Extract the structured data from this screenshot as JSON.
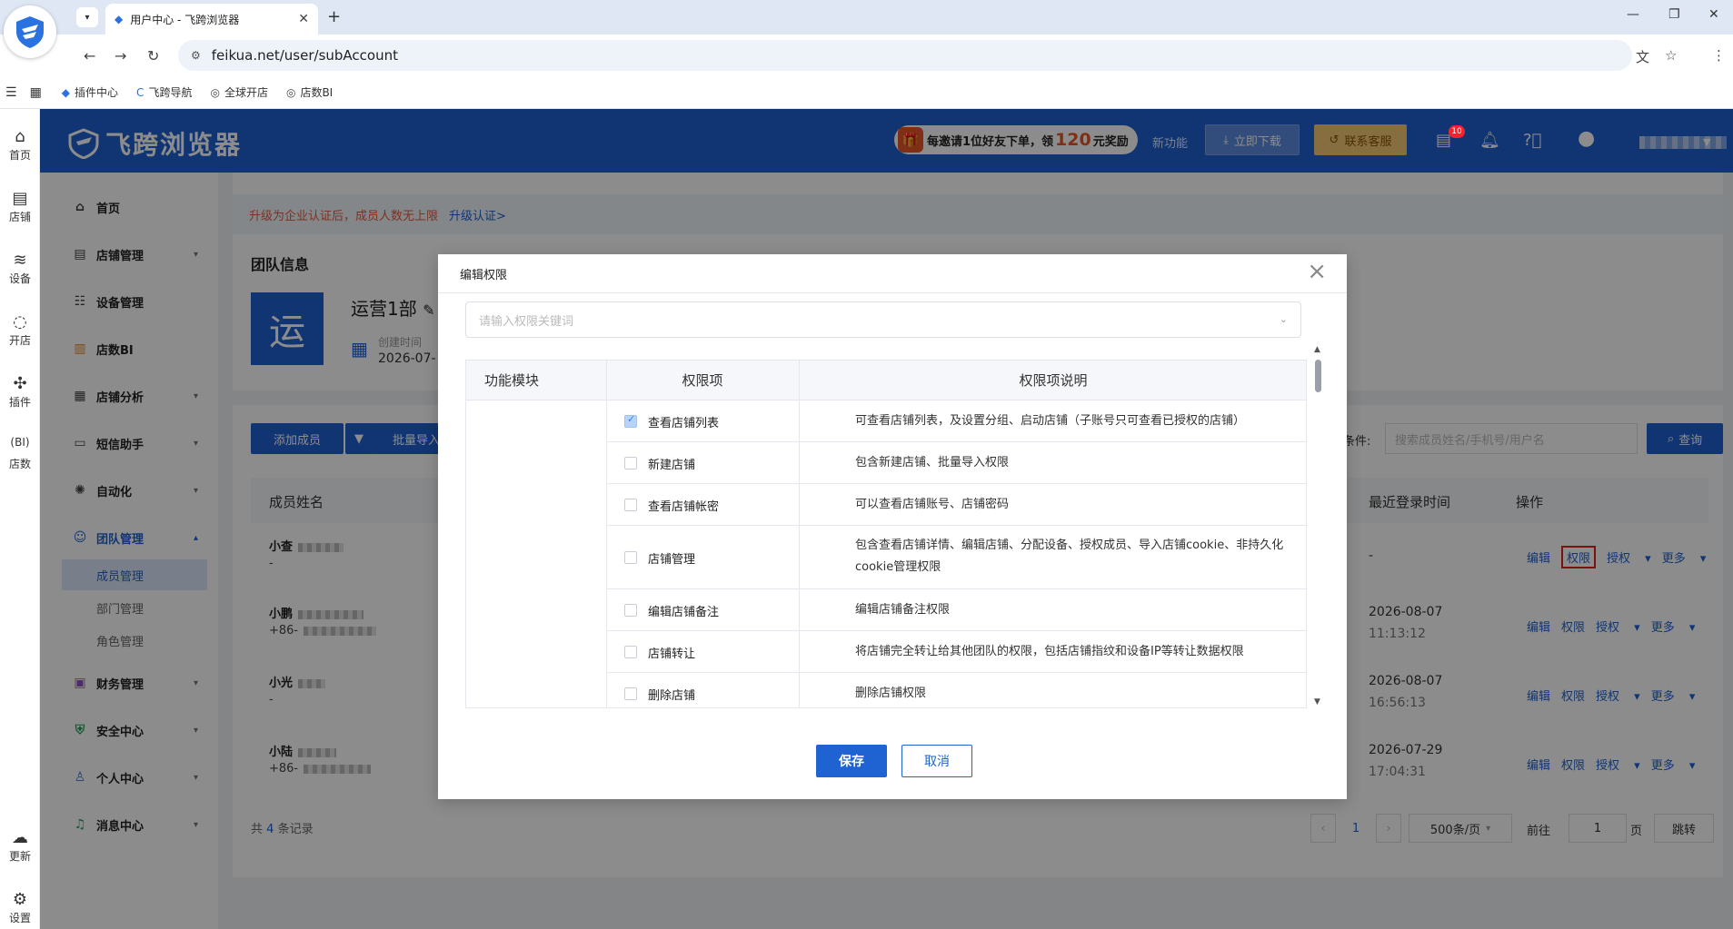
{
  "browser": {
    "tab_title": "用户中心 - 飞跨浏览器",
    "url": "feikua.net/user/subAccount",
    "bookmarks": [
      "插件中心",
      "飞跨导航",
      "全球开店",
      "店数BI"
    ]
  },
  "rail": {
    "items": [
      "首页",
      "店铺",
      "设备",
      "开店",
      "插件",
      "店数"
    ],
    "bottom": [
      "更新",
      "设置"
    ]
  },
  "header": {
    "logo": "飞跨浏览器",
    "promo_pre": "每邀请1位好友下单，领",
    "promo_num": "120",
    "promo_post": "元奖励",
    "new_features": "新功能",
    "download": "立即下载",
    "contact": "联系客服",
    "bell_count": "10"
  },
  "sidebar": {
    "items": [
      "首页",
      "店铺管理",
      "设备管理",
      "店数BI",
      "店铺分析",
      "短信助手",
      "自动化",
      "团队管理",
      "财务管理",
      "安全中心",
      "个人中心",
      "消息中心"
    ],
    "team_sub": [
      "成员管理",
      "部门管理",
      "角色管理"
    ]
  },
  "main": {
    "notice": "升级为企业认证后，成员人数无上限",
    "notice_link": "升级认证>",
    "team_info_title": "团队信息",
    "team_avatar": "运",
    "team_name": "运营1部",
    "created_label": "创建时间",
    "created_value": "2026-07-",
    "add_member": "添加成员",
    "batch_import": "批量导入",
    "search_cond": "条件:",
    "search_placeholder": "搜索成员姓名/手机号/用户名",
    "search_btn": "查询",
    "col_name": "成员姓名",
    "col_last_login": "最近登录时间",
    "col_ops": "操作",
    "rows": [
      {
        "name": "小查",
        "sub": "-",
        "date": "-",
        "time": ""
      },
      {
        "name": "小鹏",
        "sub": "+86-",
        "date": "2026-08-07",
        "time": "11:13:12"
      },
      {
        "name": "小光",
        "sub": "-",
        "date": "2026-08-07",
        "time": "16:56:13"
      },
      {
        "name": "小陆",
        "sub": "+86-",
        "date": "2026-07-29",
        "time": "17:04:31"
      }
    ],
    "op_edit": "编辑",
    "op_perm": "权限",
    "op_auth": "授权",
    "op_more": "更多",
    "total_pre": "共",
    "total_num": "4",
    "total_post": "条记录",
    "page": "1",
    "page_size": "500条/页",
    "goto": "前往",
    "goto_val": "1",
    "page_unit": "页",
    "jump": "跳转"
  },
  "modal": {
    "title": "编辑权限",
    "search_placeholder": "请输入权限关键词",
    "col_module": "功能模块",
    "col_item": "权限项",
    "col_desc": "权限项说明",
    "rows": [
      {
        "name": "查看店铺列表",
        "desc": "可查看店铺列表，及设置分组、启动店铺（子账号只可查看已授权的店铺）",
        "checked": true
      },
      {
        "name": "新建店铺",
        "desc": "包含新建店铺、批量导入权限",
        "checked": false
      },
      {
        "name": "查看店铺帐密",
        "desc": "可以查看店铺账号、店铺密码",
        "checked": false
      },
      {
        "name": "店铺管理",
        "desc": "包含查看店铺详情、编辑店铺、分配设备、授权成员、导入店铺cookie、非持久化cookie管理权限",
        "checked": false
      },
      {
        "name": "编辑店铺备注",
        "desc": "编辑店铺备注权限",
        "checked": false
      },
      {
        "name": "店铺转让",
        "desc": "将店铺完全转让给其他团队的权限，包括店铺指纹和设备IP等转让数据权限",
        "checked": false
      },
      {
        "name": "删除店铺",
        "desc": "删除店铺权限",
        "checked": false
      }
    ],
    "save": "保存",
    "cancel": "取消"
  },
  "colors": {
    "primary": "#1f62d1",
    "promo": "#e8572b",
    "highlight_box": "#e02020"
  }
}
